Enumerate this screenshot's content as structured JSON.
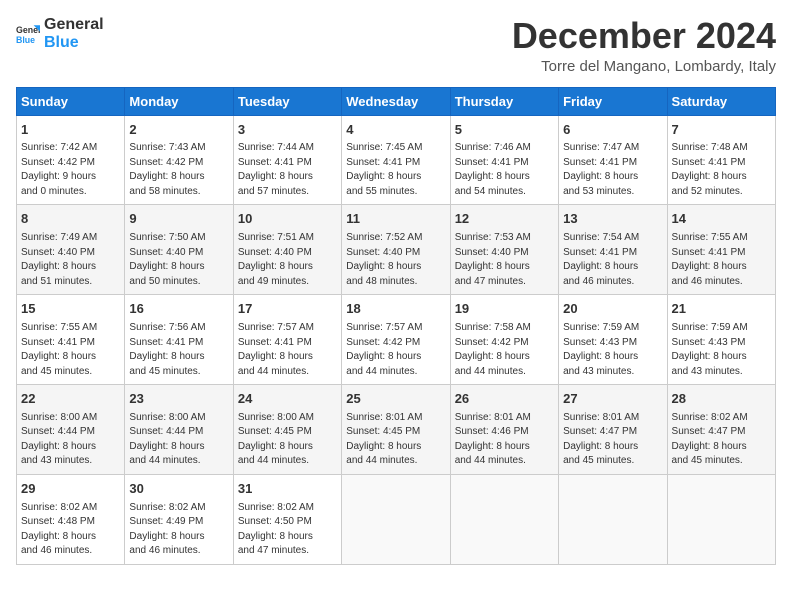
{
  "header": {
    "logo_general": "General",
    "logo_blue": "Blue",
    "month": "December 2024",
    "location": "Torre del Mangano, Lombardy, Italy"
  },
  "columns": [
    "Sunday",
    "Monday",
    "Tuesday",
    "Wednesday",
    "Thursday",
    "Friday",
    "Saturday"
  ],
  "weeks": [
    [
      {
        "day": "1",
        "info": "Sunrise: 7:42 AM\nSunset: 4:42 PM\nDaylight: 9 hours\nand 0 minutes."
      },
      {
        "day": "2",
        "info": "Sunrise: 7:43 AM\nSunset: 4:42 PM\nDaylight: 8 hours\nand 58 minutes."
      },
      {
        "day": "3",
        "info": "Sunrise: 7:44 AM\nSunset: 4:41 PM\nDaylight: 8 hours\nand 57 minutes."
      },
      {
        "day": "4",
        "info": "Sunrise: 7:45 AM\nSunset: 4:41 PM\nDaylight: 8 hours\nand 55 minutes."
      },
      {
        "day": "5",
        "info": "Sunrise: 7:46 AM\nSunset: 4:41 PM\nDaylight: 8 hours\nand 54 minutes."
      },
      {
        "day": "6",
        "info": "Sunrise: 7:47 AM\nSunset: 4:41 PM\nDaylight: 8 hours\nand 53 minutes."
      },
      {
        "day": "7",
        "info": "Sunrise: 7:48 AM\nSunset: 4:41 PM\nDaylight: 8 hours\nand 52 minutes."
      }
    ],
    [
      {
        "day": "8",
        "info": "Sunrise: 7:49 AM\nSunset: 4:40 PM\nDaylight: 8 hours\nand 51 minutes."
      },
      {
        "day": "9",
        "info": "Sunrise: 7:50 AM\nSunset: 4:40 PM\nDaylight: 8 hours\nand 50 minutes."
      },
      {
        "day": "10",
        "info": "Sunrise: 7:51 AM\nSunset: 4:40 PM\nDaylight: 8 hours\nand 49 minutes."
      },
      {
        "day": "11",
        "info": "Sunrise: 7:52 AM\nSunset: 4:40 PM\nDaylight: 8 hours\nand 48 minutes."
      },
      {
        "day": "12",
        "info": "Sunrise: 7:53 AM\nSunset: 4:40 PM\nDaylight: 8 hours\nand 47 minutes."
      },
      {
        "day": "13",
        "info": "Sunrise: 7:54 AM\nSunset: 4:41 PM\nDaylight: 8 hours\nand 46 minutes."
      },
      {
        "day": "14",
        "info": "Sunrise: 7:55 AM\nSunset: 4:41 PM\nDaylight: 8 hours\nand 46 minutes."
      }
    ],
    [
      {
        "day": "15",
        "info": "Sunrise: 7:55 AM\nSunset: 4:41 PM\nDaylight: 8 hours\nand 45 minutes."
      },
      {
        "day": "16",
        "info": "Sunrise: 7:56 AM\nSunset: 4:41 PM\nDaylight: 8 hours\nand 45 minutes."
      },
      {
        "day": "17",
        "info": "Sunrise: 7:57 AM\nSunset: 4:41 PM\nDaylight: 8 hours\nand 44 minutes."
      },
      {
        "day": "18",
        "info": "Sunrise: 7:57 AM\nSunset: 4:42 PM\nDaylight: 8 hours\nand 44 minutes."
      },
      {
        "day": "19",
        "info": "Sunrise: 7:58 AM\nSunset: 4:42 PM\nDaylight: 8 hours\nand 44 minutes."
      },
      {
        "day": "20",
        "info": "Sunrise: 7:59 AM\nSunset: 4:43 PM\nDaylight: 8 hours\nand 43 minutes."
      },
      {
        "day": "21",
        "info": "Sunrise: 7:59 AM\nSunset: 4:43 PM\nDaylight: 8 hours\nand 43 minutes."
      }
    ],
    [
      {
        "day": "22",
        "info": "Sunrise: 8:00 AM\nSunset: 4:44 PM\nDaylight: 8 hours\nand 43 minutes."
      },
      {
        "day": "23",
        "info": "Sunrise: 8:00 AM\nSunset: 4:44 PM\nDaylight: 8 hours\nand 44 minutes."
      },
      {
        "day": "24",
        "info": "Sunrise: 8:00 AM\nSunset: 4:45 PM\nDaylight: 8 hours\nand 44 minutes."
      },
      {
        "day": "25",
        "info": "Sunrise: 8:01 AM\nSunset: 4:45 PM\nDaylight: 8 hours\nand 44 minutes."
      },
      {
        "day": "26",
        "info": "Sunrise: 8:01 AM\nSunset: 4:46 PM\nDaylight: 8 hours\nand 44 minutes."
      },
      {
        "day": "27",
        "info": "Sunrise: 8:01 AM\nSunset: 4:47 PM\nDaylight: 8 hours\nand 45 minutes."
      },
      {
        "day": "28",
        "info": "Sunrise: 8:02 AM\nSunset: 4:47 PM\nDaylight: 8 hours\nand 45 minutes."
      }
    ],
    [
      {
        "day": "29",
        "info": "Sunrise: 8:02 AM\nSunset: 4:48 PM\nDaylight: 8 hours\nand 46 minutes."
      },
      {
        "day": "30",
        "info": "Sunrise: 8:02 AM\nSunset: 4:49 PM\nDaylight: 8 hours\nand 46 minutes."
      },
      {
        "day": "31",
        "info": "Sunrise: 8:02 AM\nSunset: 4:50 PM\nDaylight: 8 hours\nand 47 minutes."
      },
      {
        "day": "",
        "info": ""
      },
      {
        "day": "",
        "info": ""
      },
      {
        "day": "",
        "info": ""
      },
      {
        "day": "",
        "info": ""
      }
    ]
  ]
}
